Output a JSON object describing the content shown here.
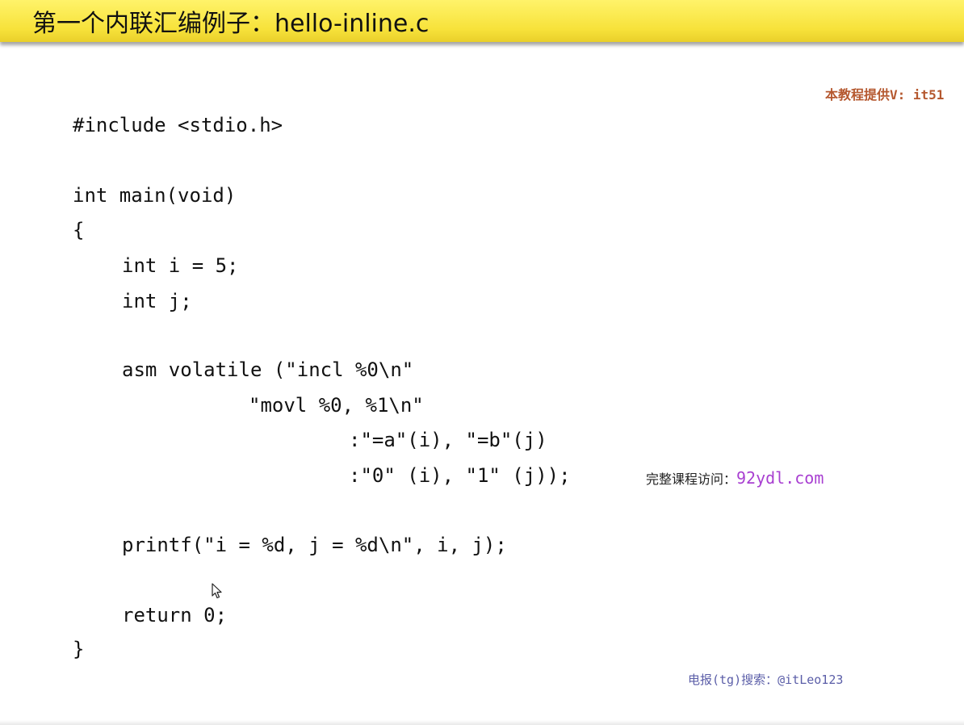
{
  "title": "第一个内联汇编例子：hello-inline.c",
  "watermark_top": "本教程提供V: it51",
  "code": {
    "line1": "#include <stdio.h>",
    "line2": "int main(void)",
    "line3": "{",
    "line4": "int i = 5;",
    "line5": "int j;",
    "line6": "asm volatile (\"incl %0\\n\"",
    "line7": "\"movl %0, %1\\n\"",
    "line8": ":\"=a\"(i), \"=b\"(j)",
    "line9": ":\"0\" (i), \"1\" (j));",
    "line10": "printf(\"i = %d, j = %d\\n\", i, j);",
    "line11": "return 0;",
    "line12": "}"
  },
  "promo": {
    "label": "完整课程访问：",
    "url": "92ydl.com"
  },
  "footer_note": "电报(tg)搜索：@itLeo123",
  "icons": {
    "cursor": "mouse-pointer-icon"
  }
}
